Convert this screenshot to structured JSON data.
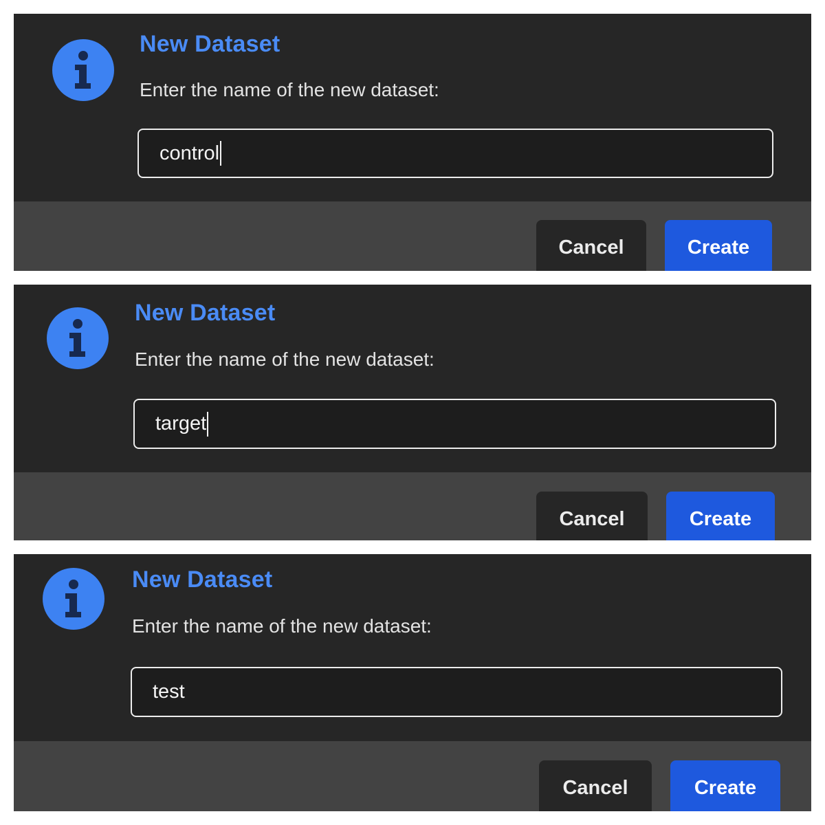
{
  "dialogs": [
    {
      "title": "New Dataset",
      "prompt": "Enter the name of the new dataset:",
      "input_value": "control",
      "show_caret": true,
      "cancel_label": "Cancel",
      "create_label": "Create"
    },
    {
      "title": "New Dataset",
      "prompt": "Enter the name of the new dataset:",
      "input_value": "target",
      "show_caret": true,
      "cancel_label": "Cancel",
      "create_label": "Create"
    },
    {
      "title": "New Dataset",
      "prompt": "Enter the name of the new dataset:",
      "input_value": "test",
      "show_caret": false,
      "cancel_label": "Cancel",
      "create_label": "Create"
    }
  ],
  "icon": "info-icon",
  "colors": {
    "panel": "#262626",
    "footer": "#434343",
    "accent": "#4a8bf5",
    "create_button": "#1e59de"
  }
}
